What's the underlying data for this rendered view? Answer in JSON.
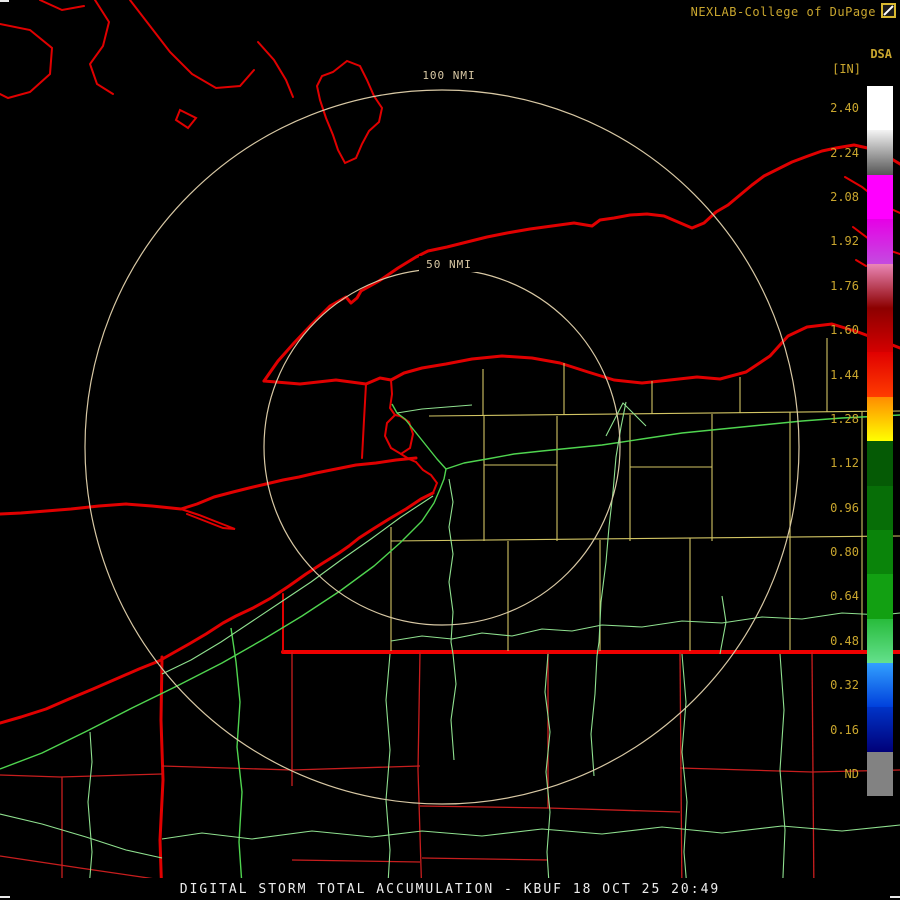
{
  "header": {
    "brand": "NEXLAB-College of DuPage",
    "logo_icon": "cod-flag-icon"
  },
  "product": {
    "code": "DSA",
    "units": "[IN]"
  },
  "colorbar": {
    "rows": [
      {
        "label": "2.40",
        "style": "background:#ffffff"
      },
      {
        "label": "2.24",
        "style": "background:linear-gradient(#f4f4f4,#565656)"
      },
      {
        "label": "2.08",
        "style": "background:#ff00ff"
      },
      {
        "label": "1.92",
        "style": "background:linear-gradient(#e600e6,#c44be0)"
      },
      {
        "label": "1.76",
        "style": "background:linear-gradient(#ea86b6,#8c0000)"
      },
      {
        "label": "1.60",
        "style": "background:linear-gradient(#8c0000,#d40000)"
      },
      {
        "label": "1.44",
        "style": "background:linear-gradient(#e00000,#ff3c00)"
      },
      {
        "label": "1.28",
        "style": "background:linear-gradient(#ff8c00,#ffff00)"
      },
      {
        "label": "1.12",
        "style": "background:#055a05"
      },
      {
        "label": "0.96",
        "style": "background:#076e07"
      },
      {
        "label": "0.80",
        "style": "background:#0a840a"
      },
      {
        "label": "0.64",
        "style": "background:#12a012"
      },
      {
        "label": "0.48",
        "style": "background:linear-gradient(#28bc3c,#64e08c)"
      },
      {
        "label": "0.32",
        "style": "background:linear-gradient(#32a0ff,#0040dc)"
      },
      {
        "label": "0.16",
        "style": "background:linear-gradient(#0034c8,#000078)"
      },
      {
        "label": "ND",
        "style": "background:#828282"
      }
    ]
  },
  "map": {
    "rings": [
      {
        "label": "100 NMI"
      },
      {
        "label": "50 NMI"
      }
    ]
  },
  "footer": {
    "title": "DIGITAL STORM TOTAL ACCUMULATION - KBUF 18 OCT 25 20:49"
  },
  "palette": {
    "background": "#000000",
    "border_red": "#e00000",
    "county_yellow": "#d2c564",
    "highway_green": "#4fd44f",
    "ring_tan": "#d8c8a4",
    "text_gold": "#c9a62e",
    "footer_text": "#ededed"
  }
}
